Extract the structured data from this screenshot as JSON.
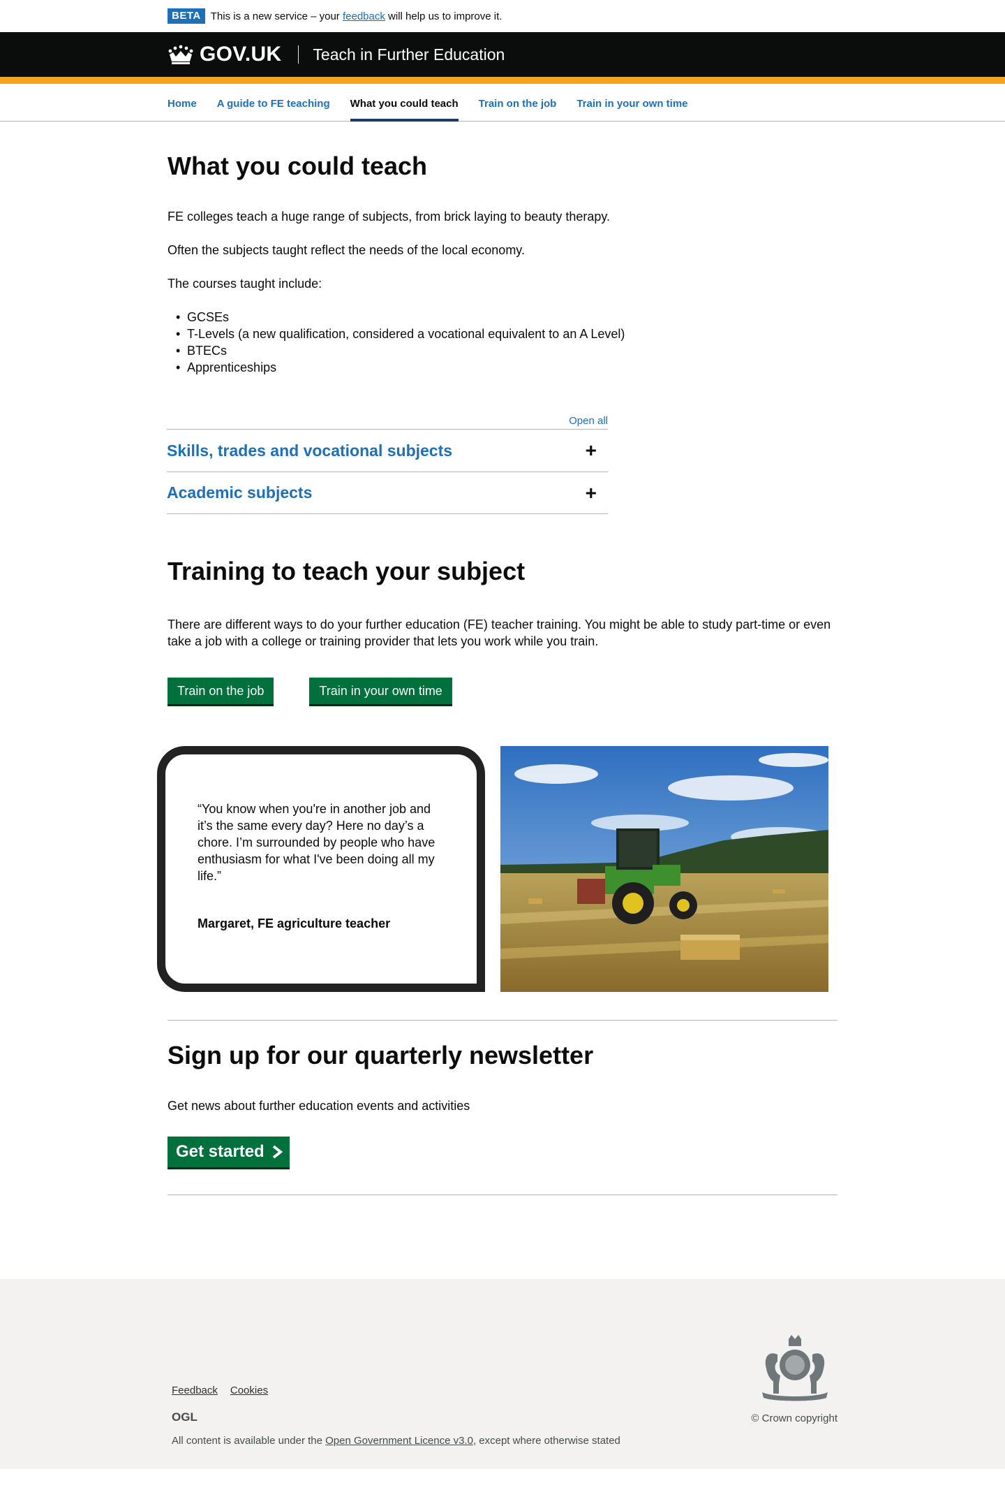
{
  "phase_banner": {
    "tag": "BETA",
    "text_before": "This is a new service – your ",
    "link": "feedback",
    "text_after": " will help us to improve it."
  },
  "header": {
    "logo": "GOV.UK",
    "service_name": "Teach in Further Education"
  },
  "nav": {
    "items": [
      {
        "label": "Home",
        "active": false
      },
      {
        "label": "A guide to FE teaching",
        "active": false
      },
      {
        "label": "What you could teach",
        "active": true
      },
      {
        "label": "Train on the job",
        "active": false
      },
      {
        "label": "Train in your own time",
        "active": false
      }
    ]
  },
  "main": {
    "title": "What you could teach",
    "intro": [
      "FE colleges teach a huge range of subjects, from brick laying to beauty therapy.",
      "Often the subjects taught reflect the needs of the local economy.",
      "The courses taught include:"
    ],
    "courses": [
      "GCSEs",
      "T-Levels (a new qualification, considered a vocational equivalent to an A Level)",
      "BTECs",
      "Apprenticeships"
    ],
    "accordion": {
      "open_all": "Open all",
      "sections": [
        {
          "title": "Skills, trades and vocational subjects",
          "icon": "+"
        },
        {
          "title": "Academic subjects",
          "icon": "+"
        }
      ]
    },
    "training": {
      "title": "Training to teach your subject",
      "text": "There are different ways to do your further education (FE) teacher training. You might be able to study part-time or even take a job with a college or training provider that lets you work while you train.",
      "buttons": [
        "Train on the job",
        "Train in your own time"
      ]
    },
    "quote": {
      "text": "“You know when you're in another job and it’s the same every day? Here no day’s a chore. I’m surrounded by people who have enthusiasm for what I've been doing all my life.”",
      "author": "Margaret, FE agriculture teacher"
    },
    "newsletter": {
      "title": "Sign up for our  quarterly newsletter",
      "text": "Get news about further education events and activities",
      "button": "Get started"
    }
  },
  "footer": {
    "links": [
      "Feedback",
      "Cookies"
    ],
    "ogl": "OGL",
    "licence_before": "All content is available under the ",
    "licence_link": "Open Government Licence v3.0",
    "licence_after": ", except where otherwise stated",
    "copyright": "© Crown copyright"
  },
  "colors": {
    "brand_blue": "#1d70b8",
    "header_black": "#0b0c0c",
    "header_stripe": "#f4a31c",
    "button_green": "#00703c",
    "footer_bg": "#f3f2f1"
  }
}
